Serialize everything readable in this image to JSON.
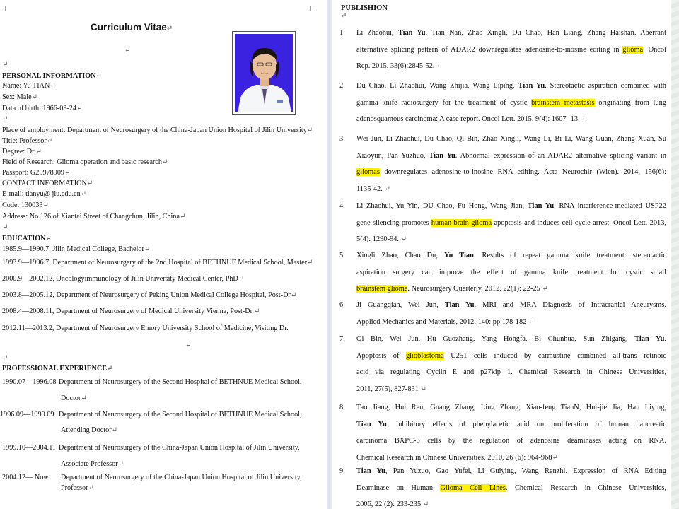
{
  "left": {
    "title": "Curriculum Vitae",
    "photo_alt": "portrait-photo",
    "personal": {
      "heading": "PERSONAL INFORMATION",
      "name": "Name: Yu TIAN",
      "sex": "Sex: Male",
      "dob": "Data of birth: 1966-03-24",
      "employment": "Place of employment: Department of Neurosurgery of the China-Japan Union Hospital of Jilin University",
      "title": "Title: Professor",
      "degree": "Degree: Dr.",
      "field": "Field of Research: Glioma operation and basic research",
      "passport": "Passport: G25978909"
    },
    "contact": {
      "heading": "CONTACT INFORMATION",
      "email": "E-mail: tianyu@ jlu.edu.cn",
      "code": "Code: 130033",
      "address": "Address: No.126 of Xiantai Street of Changchun, Jilin, China"
    },
    "education": {
      "heading": "EDUCATION",
      "items": [
        "1985.9—1990.7, Jilin Medical College, Bachelor",
        "1993.9—1996.7, Department of Neurosurgery of the 2nd Hospital of BETHNUE Medical School, Master",
        "2000.9—2002.12, Oncologyimmunology of Jilin University Medical Center, PhD",
        "2003.8—2005.12, Department of Neurosurgery of Peking Union Medical College Hospital, Post-Dr",
        "2008.4—2008.11, Department of Neurosurgery of Medical University Vienna, Post-Dr.",
        "2012.11—2013.2, Department of Neurosurgery Emory University School of Medicine, Visiting Dr."
      ]
    },
    "experience": {
      "heading": "PROFESSIONAL EXPERIENCE",
      "items": [
        {
          "date": "1990.07—1996.08",
          "desc1": "Department of Neurosurgery of the Second Hospital of BETHNUE Medical School,",
          "desc2": "Doctor"
        },
        {
          "date": "1996.09—1999.09",
          "desc1": "Department of Neurosurgery of the Second Hospital of BETHNUE Medical School,",
          "desc2": "Attending Doctor"
        },
        {
          "date": "1999.10—2004.11",
          "desc1": "Department of Neurosurgery of the China-Japan Union Hospital of Jilin University,",
          "desc2": "Associate Professor"
        },
        {
          "date": "2004.12— Now",
          "desc1": "Department of Neurosurgery of the China-Japan Union Hospital of Jilin University,",
          "desc2": "Professor"
        }
      ]
    }
  },
  "right": {
    "heading": "PUBLISHION",
    "publications": [
      {
        "num": "1.",
        "lines": [
          [
            {
              "t": "Li Zhaohui, "
            },
            {
              "t": "Tian Yu",
              "b": 1
            },
            {
              "t": ", Tian Nan, Zhao Xingli, Du Chao, Han Liang, Zhang Haishan. Aberrant"
            }
          ],
          [
            {
              "t": "alternative splicing pattern of ADAR2 downregulates adenosine-to-inosine editing in "
            },
            {
              "t": "glioma",
              "h": 1
            },
            {
              "t": ". Oncol"
            }
          ],
          [
            {
              "t": "Rep. 2015, 33(6):2845-52. "
            }
          ]
        ]
      },
      {
        "num": "2.",
        "lines": [
          [
            {
              "t": "Du Chao, Li Zhaohui, Wang Zhijia, Wang Liping, "
            },
            {
              "t": "Tian Yu",
              "b": 1
            },
            {
              "t": ". Stereotactic aspiration combined with"
            }
          ],
          [
            {
              "t": "gamma knife radiosurgery for the treatment of cystic "
            },
            {
              "t": "brainstem metastasis",
              "h": 1
            },
            {
              "t": " originating from lung"
            }
          ],
          [
            {
              "t": "adenosquamous carcinoma: A case report. Oncol Lett. 2015, 9(4): 1607 -13. "
            }
          ]
        ]
      },
      {
        "num": "3.",
        "lines": [
          [
            {
              "t": "Wei Jun, Li Zhaohui, Du Chao, Qi Bin, Zhao Xingli, Wang Li, Bi Li, Wang Guan, Zhang Xuan, Su"
            }
          ],
          [
            {
              "t": "Xiaoyun, Pan Yuzhuo, "
            },
            {
              "t": "Tian Yu",
              "b": 1
            },
            {
              "t": ". Abnormal expression of an ADAR2 alternative splicing variant in"
            }
          ],
          [
            {
              "t": "gliomas",
              "h": 1
            },
            {
              "t": " downregulates adenosine-to-inosine RNA editing. Acta Neurochir (Wien). 2014, 156(6):"
            }
          ],
          [
            {
              "t": "1135-42. "
            }
          ]
        ]
      },
      {
        "num": "4.",
        "lines": [
          [
            {
              "t": "Li Zhaohui, Yu Yin, DU Chao, Fu Hong, Wang Jian, "
            },
            {
              "t": "Tian Yu",
              "b": 1
            },
            {
              "t": ". RNA interference-mediated USP22"
            }
          ],
          [
            {
              "t": "gene silencing promotes "
            },
            {
              "t": "human brain glioma",
              "h": 1
            },
            {
              "t": " apoptosis and induces cell cycle arrest. Oncol Lett. 2013,"
            }
          ],
          [
            {
              "t": "5(4): 1290-94. "
            }
          ]
        ]
      },
      {
        "num": "5.",
        "lines": [
          [
            {
              "t": "Xingli Zhao, Chao Du, "
            },
            {
              "t": "Yu Tian",
              "b": 1
            },
            {
              "t": ". Results of repeat gamma knife treatment: stereotactic"
            }
          ],
          [
            {
              "t": "aspiration surgery can improve the effect of gamma knife treatment for cystic small"
            }
          ],
          [
            {
              "t": "brainstem glioma",
              "h": 1
            },
            {
              "t": ". Neurosurgery Quarterly, 2012, 22(1): 22-25 "
            }
          ]
        ]
      },
      {
        "num": "6.",
        "lines": [
          [
            {
              "t": "Ji Guangqian, Wei Jun, "
            },
            {
              "t": "Tian Yu",
              "b": 1
            },
            {
              "t": ". MRI and MRA Diagnosis of Intracranial Aneurysms."
            }
          ],
          [
            {
              "t": "Applied Mechanics and Materials, 2012, 140: pp 178-182 "
            }
          ]
        ]
      },
      {
        "num": "7.",
        "lines": [
          [
            {
              "t": "Qi Bin, Wei Jun, Hu Guozhang, Yang Hongfa, Bi Chunhua, Sun Zhigang, "
            },
            {
              "t": "Tian Yu",
              "b": 1
            },
            {
              "t": "."
            }
          ],
          [
            {
              "t": "Apoptosis of "
            },
            {
              "t": "glioblastoma",
              "h": 1
            },
            {
              "t": " U251 cells induced by carmustine combined all-trans retinoic"
            }
          ],
          [
            {
              "t": "acid via regulating Cyclin E and p27kip 1. Chemical Research in Chinese Universities,"
            }
          ],
          [
            {
              "t": "2011, 27(5), 827-831 "
            }
          ]
        ]
      },
      {
        "num": "8.",
        "lines": [
          [
            {
              "t": "Tao Jiang, Hui Ren, Guang Zhang, Ling Zhang, Xiao-feng TianN, Hui-jie Jia, Han Liying,"
            }
          ],
          [
            {
              "t": "Tian Yu",
              "b": 1
            },
            {
              "t": ". Inhibitory effects of phenylacetic acid on proliferation of human pancreatic"
            }
          ],
          [
            {
              "t": "carcinoma BXPC-3 cells by the regulation of adenosine deaminases acting on RNA."
            }
          ],
          [
            {
              "t": "Chemical Research in Chinese Universities, 2010, 26 (6): 964-968"
            }
          ]
        ]
      },
      {
        "num": "9.",
        "lines": [
          [
            {
              "t": "Tian Yu",
              "b": 1
            },
            {
              "t": ", Pan Yuzuo, Gao Yufei, Li Guiying, Wang Renzhi. Expression of RNA Editing"
            }
          ],
          [
            {
              "t": "Deaminase on Human "
            },
            {
              "t": "Glioma Cell Lines",
              "h": 1
            },
            {
              "t": ". Chemical Research in Chinese Universities,"
            }
          ],
          [
            {
              "t": "2006, 22 (2): 233-235 "
            }
          ]
        ]
      }
    ]
  },
  "colors": {
    "highlight": "#fff200",
    "photo_bg": "#3b22e0",
    "text": "#111111"
  },
  "marks": {
    "paragraph": "↵"
  }
}
